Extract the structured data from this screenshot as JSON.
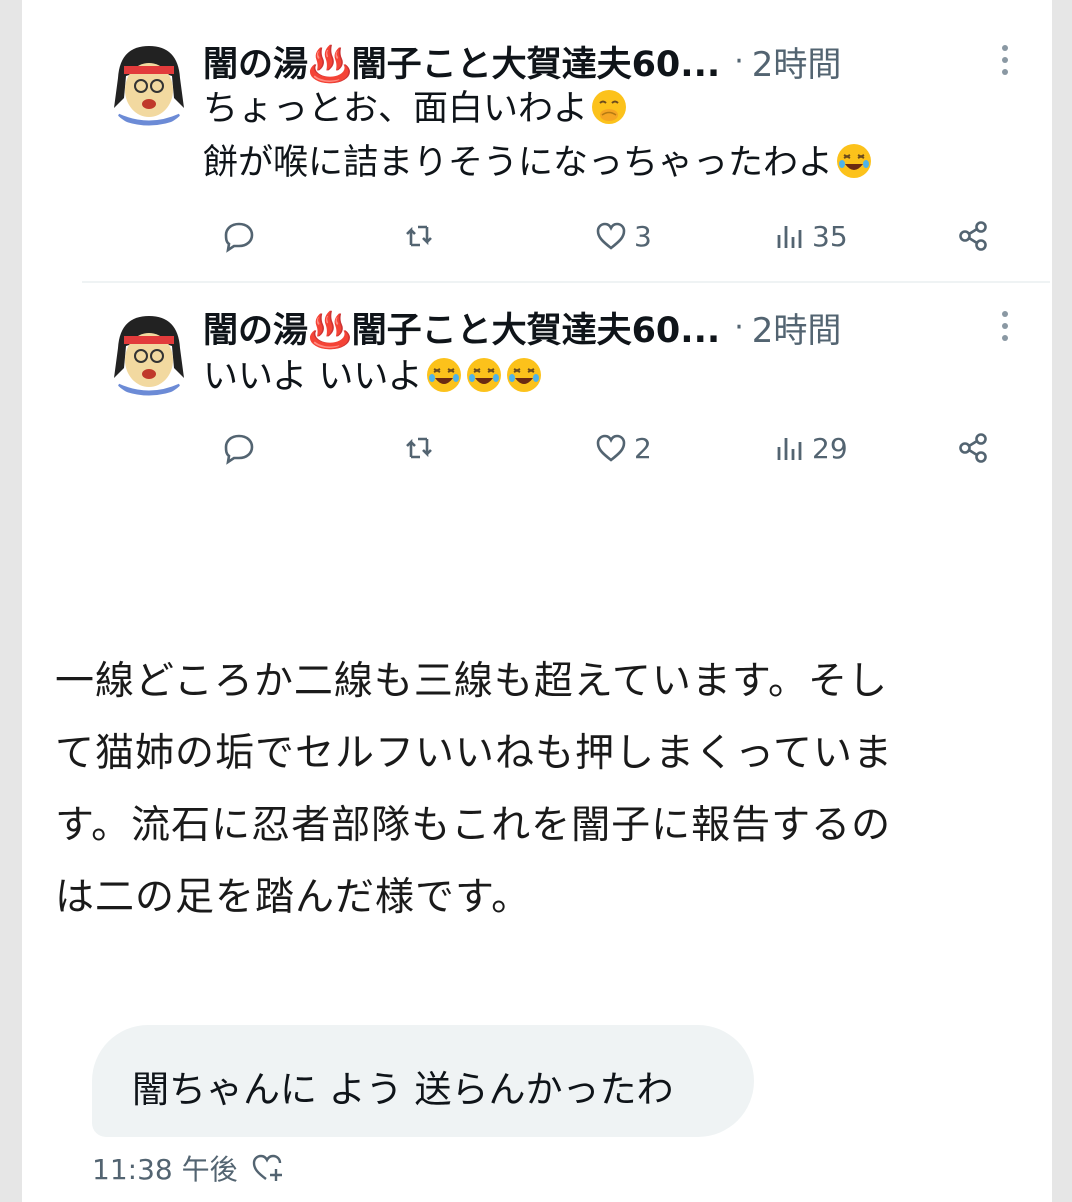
{
  "tweets": [
    {
      "author": "闇の湯♨️闇子こと大賀達夫60...",
      "separator": "·",
      "time": "2時間",
      "lines": [
        "ちょっとお、面白いわよ",
        "餅が喉に詰まりそうになっちゃったわよ"
      ],
      "likes": "3",
      "views": "35"
    },
    {
      "author": "闇の湯♨️闇子こと大賀達夫60...",
      "separator": "·",
      "time": "2時間",
      "lines": [
        "いいよ いいよ"
      ],
      "likes": "2",
      "views": "29"
    }
  ],
  "prose": {
    "lines": [
      "一線どころか二線も三線も超えています。そし",
      "て猫姉の垢でセルフいいねも押しまくっていま",
      "す。流石に忍者部隊もこれを闇子に報告するの",
      "は二の足を踏んだ様です。"
    ]
  },
  "dm": {
    "message": "闇ちゃんに よう 送らんかったわ",
    "time": "11:38 午後"
  },
  "icons": {
    "reply": "reply-icon",
    "retweet": "retweet-icon",
    "like": "heart-icon",
    "views": "views-icon",
    "share": "share-icon",
    "more": "more-vertical-icon",
    "react": "add-reaction-icon"
  },
  "colors": {
    "text": "#0f1419",
    "muted": "#536471",
    "bubble": "#eff3f4"
  }
}
